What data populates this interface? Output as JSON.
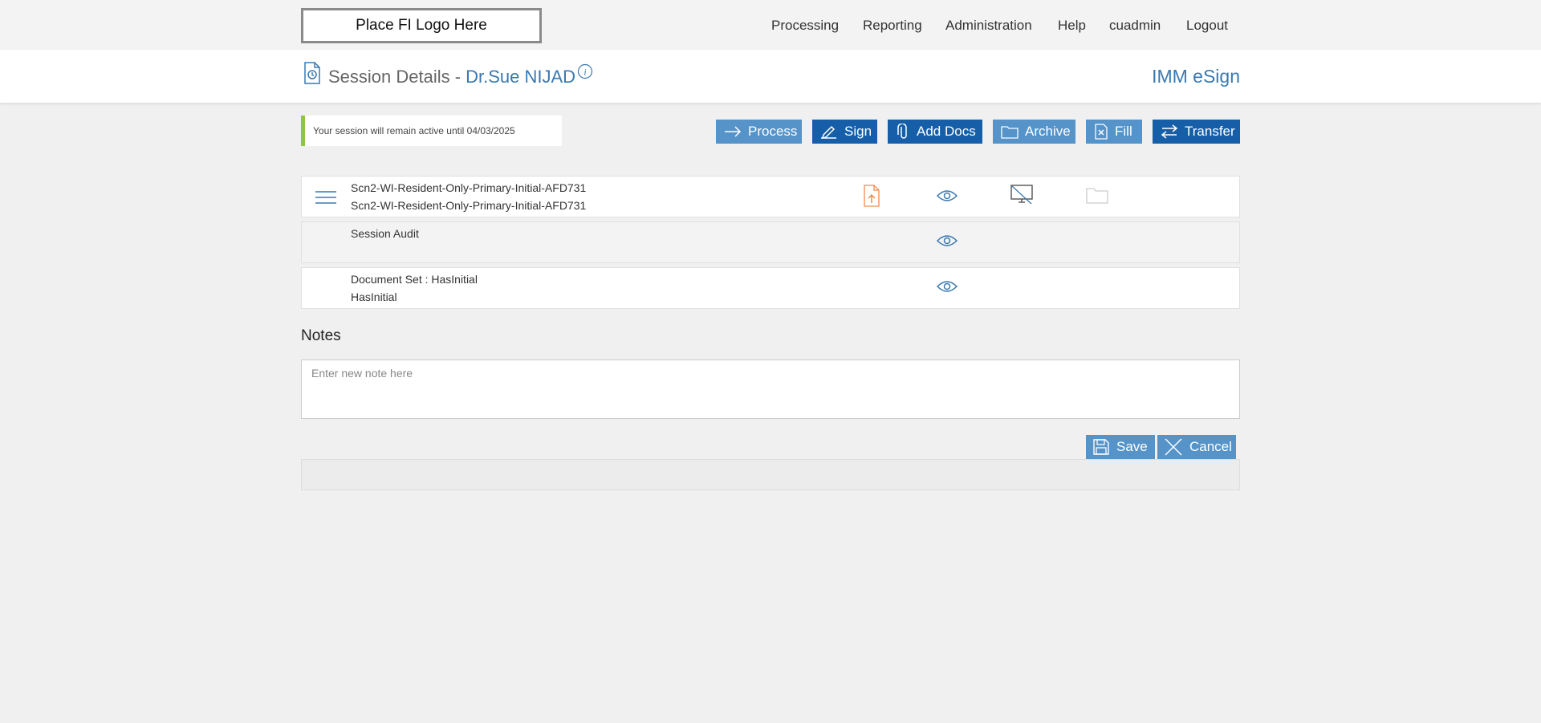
{
  "logo": {
    "text": "Place FI Logo Here"
  },
  "nav": {
    "items": [
      "Processing",
      "Reporting",
      "Administration",
      "Help",
      "cuadmin",
      "Logout"
    ]
  },
  "header": {
    "title": "Session Details -",
    "name": "Dr.Sue NIJAD",
    "brand": "IMM eSign"
  },
  "notice": {
    "text": "Your session will remain active until 04/03/2025"
  },
  "actions": {
    "process": "Process",
    "sign": "Sign",
    "add_docs": "Add Docs",
    "archive": "Archive",
    "fill": "Fill",
    "transfer": "Transfer"
  },
  "documents": [
    {
      "line1": "Scn2-WI-Resident-Only-Primary-Initial-AFD731",
      "line2": "Scn2-WI-Resident-Only-Primary-Initial-AFD731"
    },
    {
      "line1": "Session Audit",
      "line2": ""
    },
    {
      "line1": "Document Set : HasInitial",
      "line2": "HasInitial"
    }
  ],
  "notes": {
    "heading": "Notes",
    "placeholder": "Enter new note here",
    "save": "Save",
    "cancel": "Cancel"
  },
  "colors": {
    "accent": "#3a78b0",
    "button_light": "#5593c8",
    "button_dark": "#165fa8",
    "notice_bar": "#8dc63f",
    "upload_icon": "#f08a4b"
  },
  "icons": [
    "history-icon",
    "info-icon",
    "menu-icon",
    "upload-file-icon",
    "eye-icon",
    "monitor-off-icon",
    "folder-icon",
    "arrow-right-icon",
    "pen-icon",
    "paperclip-icon",
    "doc-x-icon",
    "swap-icon",
    "floppy-icon",
    "close-icon"
  ]
}
